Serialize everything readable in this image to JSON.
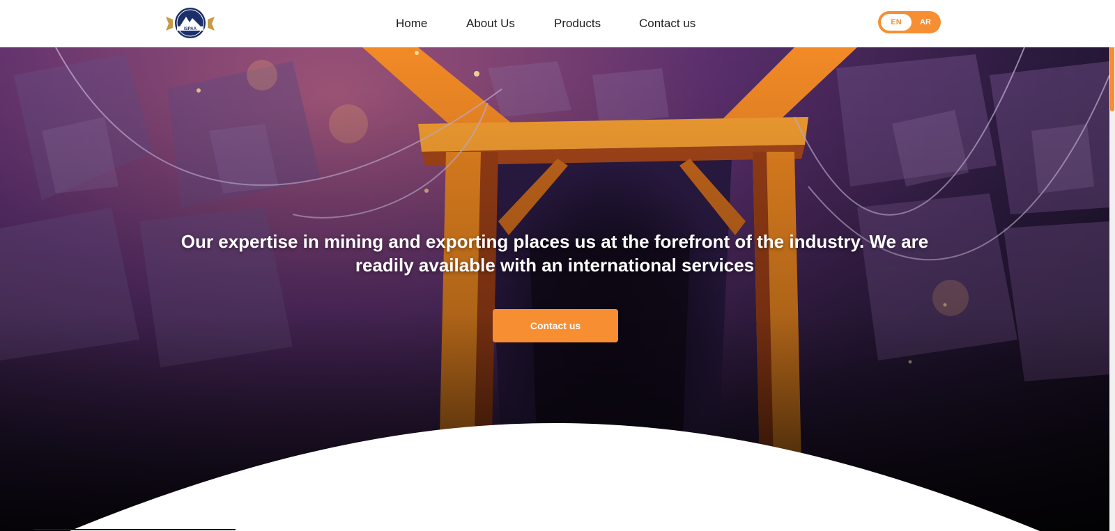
{
  "header": {
    "logo_text": "ISPAA",
    "nav": {
      "home": "Home",
      "about": "About Us",
      "products": "Products",
      "contact": "Contact us"
    },
    "language": {
      "en": "EN",
      "ar": "AR",
      "active": "EN"
    }
  },
  "hero": {
    "heading": "Our expertise in mining and exporting places us at the forefront of the industry. We are readily available with an international services",
    "cta": "Contact us",
    "illustration": "mine-entrance-illustration"
  },
  "colors": {
    "accent": "#f78e32",
    "text": "#1e1e1e",
    "logo_navy": "#1c2f6b",
    "logo_gold": "#c79a45"
  }
}
